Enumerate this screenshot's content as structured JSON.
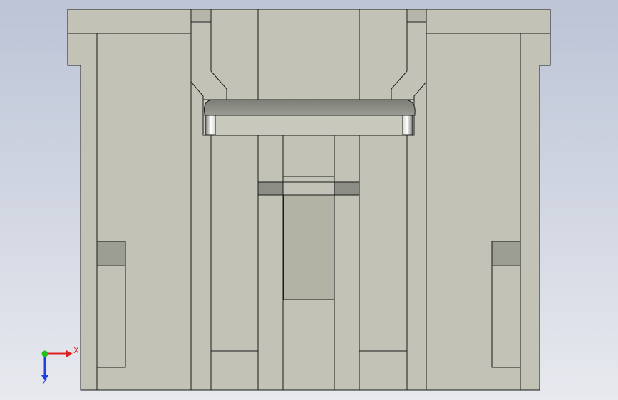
{
  "viewport": {
    "background_top": "#bcc4d6",
    "background_bottom": "#e7e9ee"
  },
  "model": {
    "face_color": "#c2c3b6",
    "edge_color": "#1a1a1a",
    "pocket_color": "#a9aa9c",
    "insert_color": "#8c8d84"
  },
  "triad": {
    "x_label": "X",
    "z_label": "Z",
    "x_color": "#e02020",
    "y_color": "#20c020",
    "z_color": "#2040e0"
  }
}
